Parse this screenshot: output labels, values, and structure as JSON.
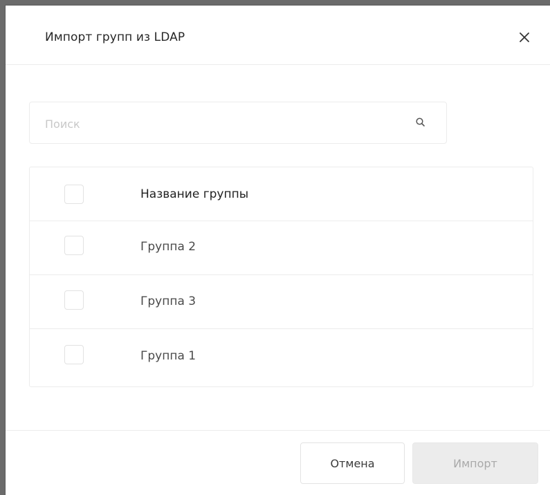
{
  "dialog": {
    "title": "Импорт групп из LDAP"
  },
  "search": {
    "placeholder": "Поиск",
    "value": ""
  },
  "table": {
    "header": "Название группы",
    "rows": [
      {
        "name": "Группа 2"
      },
      {
        "name": "Группа 3"
      },
      {
        "name": "Группа 1"
      }
    ]
  },
  "footer": {
    "cancel_label": "Отмена",
    "import_label": "Импорт"
  },
  "colors": {
    "border": "#ececec",
    "disabled_button_bg": "#ececec",
    "disabled_button_text": "#a9a9a9",
    "placeholder": "#c8c8c8"
  },
  "icons": {
    "close": "close-icon",
    "search": "search-icon"
  }
}
